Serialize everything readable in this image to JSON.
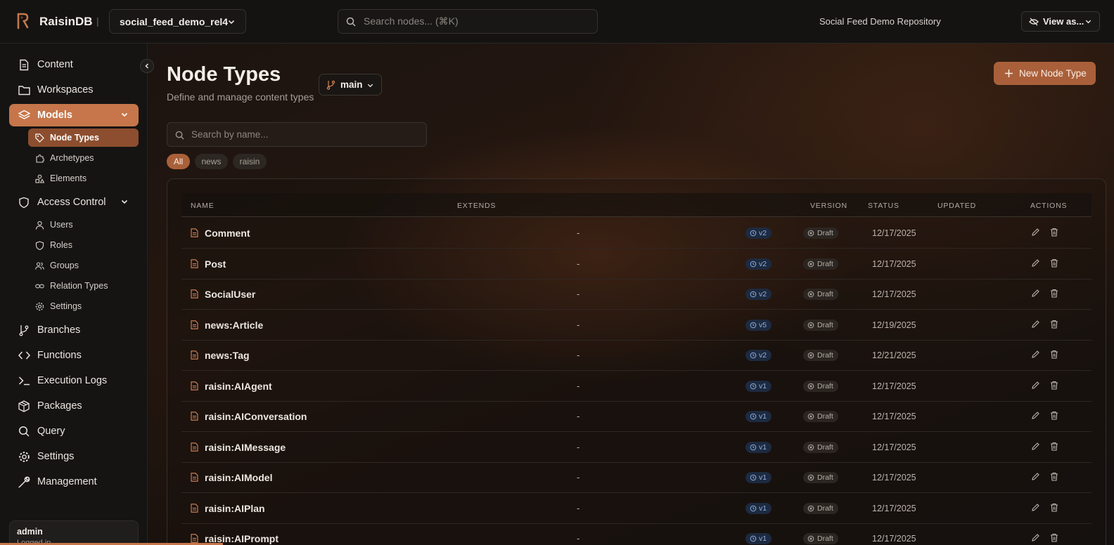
{
  "app": {
    "name": "RaisinDB",
    "repo": "social_feed_demo_rel4",
    "search_placeholder": "Search nodes... (⌘K)",
    "repo_label": "Social Feed Demo Repository",
    "view_as": "View as...",
    "separator": "|"
  },
  "sidebar": {
    "items": [
      {
        "label": "Content",
        "icon": "file-text-icon"
      },
      {
        "label": "Workspaces",
        "icon": "folder-icon"
      },
      {
        "label": "Models",
        "icon": "layers-icon"
      },
      {
        "label": "Access Control",
        "icon": "shield-icon"
      },
      {
        "label": "Branches",
        "icon": "git-branch-icon"
      },
      {
        "label": "Functions",
        "icon": "code-icon"
      },
      {
        "label": "Execution Logs",
        "icon": "terminal-icon"
      },
      {
        "label": "Packages",
        "icon": "package-icon"
      },
      {
        "label": "Query",
        "icon": "search-icon"
      },
      {
        "label": "Settings",
        "icon": "gear-icon"
      },
      {
        "label": "Management",
        "icon": "wrench-icon"
      }
    ],
    "models_sub": [
      {
        "label": "Node Types",
        "icon": "tag-icon"
      },
      {
        "label": "Archetypes",
        "icon": "puzzle-icon"
      },
      {
        "label": "Elements",
        "icon": "shapes-icon"
      }
    ],
    "access_sub": [
      {
        "label": "Users",
        "icon": "user-icon"
      },
      {
        "label": "Roles",
        "icon": "shield-small-icon"
      },
      {
        "label": "Groups",
        "icon": "users-icon"
      },
      {
        "label": "Relation Types",
        "icon": "link-icon"
      },
      {
        "label": "Settings",
        "icon": "gear-small-icon"
      }
    ],
    "user": {
      "name": "admin",
      "status": "Logged in"
    },
    "accent": "#c6764a"
  },
  "main": {
    "title": "Node Types",
    "subtitle": "Define and manage content types",
    "branch": "main",
    "new_button": "New Node Type",
    "search_placeholder": "Search by name...",
    "filters": [
      "All",
      "news",
      "raisin"
    ],
    "columns": {
      "name": "NAME",
      "extends": "EXTENDS",
      "version": "VERSION",
      "status": "STATUS",
      "updated": "UPDATED",
      "actions": "ACTIONS"
    },
    "rows": [
      {
        "name": "Comment",
        "extends": "-",
        "version": "v2",
        "status": "Draft",
        "updated": "12/17/2025"
      },
      {
        "name": "Post",
        "extends": "-",
        "version": "v2",
        "status": "Draft",
        "updated": "12/17/2025"
      },
      {
        "name": "SocialUser",
        "extends": "-",
        "version": "v2",
        "status": "Draft",
        "updated": "12/17/2025"
      },
      {
        "name": "news:Article",
        "extends": "-",
        "version": "v5",
        "status": "Draft",
        "updated": "12/19/2025"
      },
      {
        "name": "news:Tag",
        "extends": "-",
        "version": "v2",
        "status": "Draft",
        "updated": "12/21/2025"
      },
      {
        "name": "raisin:AIAgent",
        "extends": "-",
        "version": "v1",
        "status": "Draft",
        "updated": "12/17/2025"
      },
      {
        "name": "raisin:AIConversation",
        "extends": "-",
        "version": "v1",
        "status": "Draft",
        "updated": "12/17/2025"
      },
      {
        "name": "raisin:AIMessage",
        "extends": "-",
        "version": "v1",
        "status": "Draft",
        "updated": "12/17/2025"
      },
      {
        "name": "raisin:AIModel",
        "extends": "-",
        "version": "v1",
        "status": "Draft",
        "updated": "12/17/2025"
      },
      {
        "name": "raisin:AIPlan",
        "extends": "-",
        "version": "v1",
        "status": "Draft",
        "updated": "12/17/2025"
      },
      {
        "name": "raisin:AIPrompt",
        "extends": "-",
        "version": "v1",
        "status": "Draft",
        "updated": "12/17/2025"
      }
    ]
  },
  "loading_progress": 0.2
}
